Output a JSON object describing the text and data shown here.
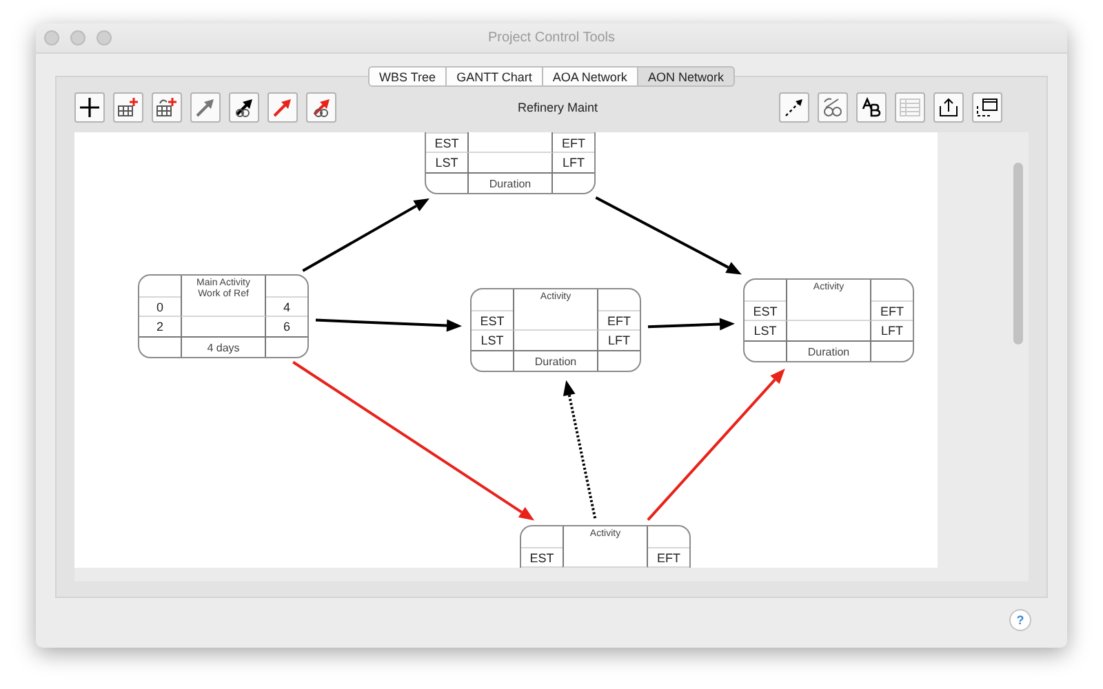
{
  "window": {
    "title": "Project Control Tools"
  },
  "tabs": [
    {
      "label": "WBS Tree",
      "selected": false
    },
    {
      "label": "GANTT Chart",
      "selected": false
    },
    {
      "label": "AOA Network",
      "selected": false
    },
    {
      "label": "AON Network",
      "selected": true
    }
  ],
  "toolbar": {
    "title": "Refinery Maint"
  },
  "network": {
    "nodes": [
      {
        "est": "EST",
        "eft": "EFT",
        "lst": "LST",
        "lft": "LFT",
        "duration": "Duration"
      },
      {
        "title": [
          "Main Activity",
          "Work of Ref"
        ],
        "est": "0",
        "eft": "4",
        "lst": "2",
        "lft": "6",
        "duration": "4 days"
      },
      {
        "title": [
          "Activity"
        ],
        "est": "EST",
        "eft": "EFT",
        "lst": "LST",
        "lft": "LFT",
        "duration": "Duration"
      },
      {
        "title": [
          "Activity"
        ],
        "est": "EST",
        "eft": "EFT",
        "lst": "LST",
        "lft": "LFT",
        "duration": "Duration"
      },
      {
        "title": [
          "Activity"
        ],
        "est": "EST",
        "eft": "EFT"
      }
    ],
    "edges": [
      {
        "color": "#000000",
        "kind": "solid"
      },
      {
        "color": "#000000",
        "kind": "solid"
      },
      {
        "color": "#000000",
        "kind": "solid"
      },
      {
        "color": "#000000",
        "kind": "solid"
      },
      {
        "color": "#e8231a",
        "kind": "solid"
      },
      {
        "color": "#e8231a",
        "kind": "solid"
      },
      {
        "color": "#000000",
        "kind": "dotted"
      }
    ]
  },
  "help_button": {
    "label": "?"
  }
}
